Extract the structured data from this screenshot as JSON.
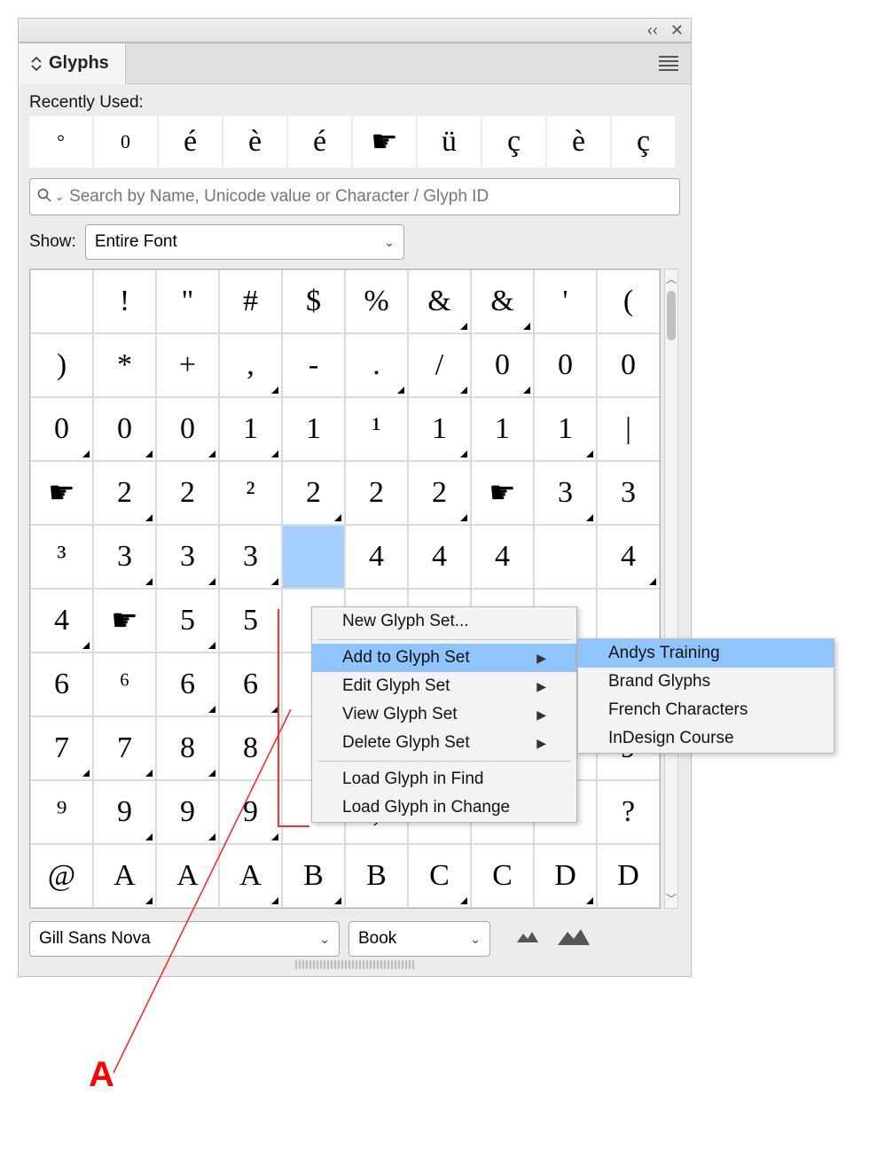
{
  "panel_title": "Glyphs",
  "recently_used_label": "Recently Used:",
  "recently_used": [
    "°",
    "0",
    "é",
    "è",
    "é",
    "☛",
    "ü",
    "ç",
    "è",
    "ç"
  ],
  "search_placeholder": "Search by Name, Unicode value or Character / Glyph ID",
  "show_label": "Show:",
  "show_value": "Entire Font",
  "font_name": "Gill Sans Nova",
  "font_style": "Book",
  "grid": [
    [
      "",
      "!",
      "\"",
      "#",
      "$",
      "%",
      "&",
      "&",
      "'",
      "("
    ],
    [
      ")",
      "*",
      "+",
      ",",
      "-",
      ".",
      "/",
      "0",
      "0",
      "0"
    ],
    [
      "0",
      "0",
      "0",
      "1",
      "1",
      "¹",
      "1",
      "1",
      "1",
      "|"
    ],
    [
      "☛",
      "2",
      "2",
      "²",
      "2",
      "2",
      "2",
      "☛",
      "3",
      "3"
    ],
    [
      "³",
      "3",
      "3",
      "3",
      "",
      "4",
      "4",
      "4",
      "",
      "4"
    ],
    [
      "4",
      "☛",
      "5",
      "5",
      "",
      "",
      "",
      "",
      "",
      ""
    ],
    [
      "6",
      "⁶",
      "6",
      "6",
      "",
      "",
      "",
      "",
      "",
      ""
    ],
    [
      "7",
      "7",
      "8",
      "8",
      "",
      "",
      "",
      "",
      "",
      "9"
    ],
    [
      "⁹",
      "9",
      "9",
      "9",
      ":",
      ";",
      "<",
      "=",
      ">",
      "?"
    ],
    [
      "@",
      "A",
      "A",
      "A",
      "B",
      "B",
      "C",
      "C",
      "D",
      "D"
    ]
  ],
  "grid_flags": [
    [
      0,
      0,
      0,
      0,
      0,
      0,
      1,
      1,
      0,
      0
    ],
    [
      0,
      0,
      0,
      1,
      0,
      1,
      1,
      1,
      0,
      0
    ],
    [
      1,
      1,
      1,
      1,
      0,
      0,
      1,
      0,
      1,
      0
    ],
    [
      0,
      1,
      0,
      0,
      1,
      0,
      1,
      0,
      1,
      0
    ],
    [
      0,
      1,
      1,
      1,
      0,
      0,
      0,
      0,
      0,
      1
    ],
    [
      1,
      0,
      1,
      0,
      0,
      0,
      0,
      0,
      0,
      0
    ],
    [
      0,
      0,
      1,
      1,
      0,
      0,
      0,
      0,
      0,
      0
    ],
    [
      1,
      1,
      1,
      0,
      0,
      0,
      0,
      0,
      0,
      0
    ],
    [
      0,
      1,
      1,
      1,
      0,
      0,
      0,
      0,
      0,
      0
    ],
    [
      0,
      1,
      0,
      1,
      1,
      0,
      1,
      0,
      1,
      0
    ]
  ],
  "selected": {
    "row": 4,
    "col": 4
  },
  "context_menu": {
    "items": [
      {
        "label": "New Glyph Set...",
        "submenu": false
      },
      {
        "sep": true
      },
      {
        "label": "Add to Glyph Set",
        "submenu": true,
        "highlight": true
      },
      {
        "label": "Edit Glyph Set",
        "submenu": true
      },
      {
        "label": "View Glyph Set",
        "submenu": true
      },
      {
        "label": "Delete Glyph Set",
        "submenu": true
      },
      {
        "sep": true
      },
      {
        "label": "Load Glyph in Find",
        "submenu": false
      },
      {
        "label": "Load Glyph in Change",
        "submenu": false
      }
    ],
    "submenu": [
      {
        "label": "Andys Training",
        "highlight": true
      },
      {
        "label": "Brand Glyphs"
      },
      {
        "label": "French Characters"
      },
      {
        "label": "InDesign Course"
      }
    ]
  },
  "annotation": "A"
}
